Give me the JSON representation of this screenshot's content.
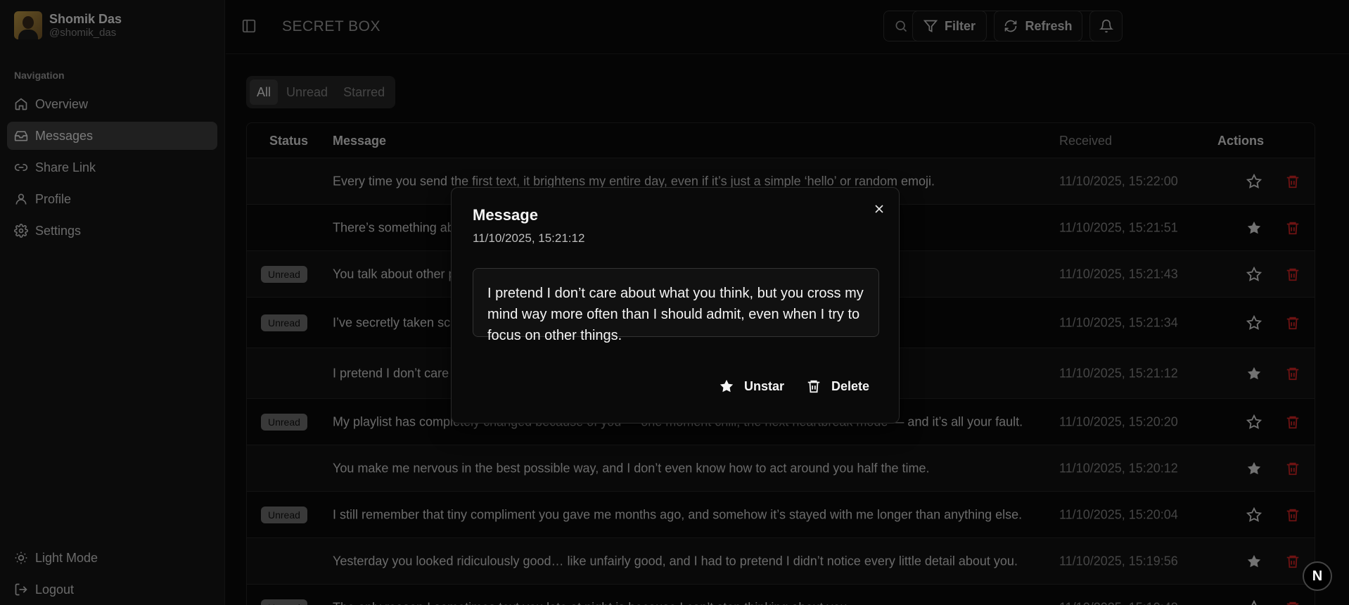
{
  "user": {
    "name": "Shomik Das",
    "handle": "@shomik_das"
  },
  "sidebar": {
    "section_label": "Navigation",
    "items": [
      {
        "label": "Overview",
        "icon": "home-icon"
      },
      {
        "label": "Messages",
        "icon": "inbox-icon",
        "active": true
      },
      {
        "label": "Share Link",
        "icon": "link-icon"
      },
      {
        "label": "Profile",
        "icon": "user-icon"
      },
      {
        "label": "Settings",
        "icon": "gear-icon"
      }
    ],
    "bottom": [
      {
        "label": "Light Mode",
        "icon": "sun-icon"
      },
      {
        "label": "Logout",
        "icon": "logout-icon"
      }
    ]
  },
  "header": {
    "title": "SECRET BOX",
    "search_placeholder": "Search...",
    "filter_label": "Filter",
    "refresh_label": "Refresh"
  },
  "tabs": [
    "All",
    "Unread",
    "Starred"
  ],
  "table": {
    "columns": {
      "status": "Status",
      "message": "Message",
      "received": "Received",
      "actions": "Actions"
    },
    "rows": [
      {
        "status": "",
        "message": "Every time you send the first text, it brightens my entire day, even if it’s just a simple ‘hello’ or random emoji.",
        "received": "11/10/2025, 15:22:00",
        "starred": false
      },
      {
        "status": "",
        "message": "There’s something ab… the most random times.",
        "received": "11/10/2025, 15:21:51",
        "starred": true
      },
      {
        "status": "Unread",
        "message": "You talk about other p… little things you do.",
        "received": "11/10/2025, 15:21:43",
        "starred": false
      },
      {
        "status": "Unread",
        "message": "I’ve secretly taken scre… w you made me feel in that moment.",
        "received": "11/10/2025, 15:21:34",
        "starred": false
      },
      {
        "status": "",
        "message": "I pretend I don’t care … even when I try to focus on other things.",
        "received": "11/10/2025, 15:21:12",
        "starred": true
      },
      {
        "status": "Unread",
        "message": "My playlist has completely changed because of you — one moment chill, the next heartbreak mode — and it’s all your fault.",
        "received": "11/10/2025, 15:20:20",
        "starred": false
      },
      {
        "status": "",
        "message": "You make me nervous in the best possible way, and I don’t even know how to act around you half the time.",
        "received": "11/10/2025, 15:20:12",
        "starred": true
      },
      {
        "status": "Unread",
        "message": "I still remember that tiny compliment you gave me months ago, and somehow it’s stayed with me longer than anything else.",
        "received": "11/10/2025, 15:20:04",
        "starred": false
      },
      {
        "status": "",
        "message": "Yesterday you looked ridiculously good… like unfairly good, and I had to pretend I didn’t notice every little detail about you.",
        "received": "11/10/2025, 15:19:56",
        "starred": true
      },
      {
        "status": "Unread",
        "message": "The only reason I sometimes text you late at night is because I can’t stop thinking about you.",
        "received": "11/10/2025, 15:19:48",
        "starred": false
      }
    ]
  },
  "modal": {
    "title": "Message",
    "timestamp": "11/10/2025, 15:21:12",
    "body": "I pretend I don’t care about what you think, but you cross my mind way more often than I should admit, even when I try to focus on other things.",
    "unstar_label": "Unstar",
    "delete_label": "Delete"
  },
  "floating_badge": "N",
  "colors": {
    "danger": "#dc2626",
    "accent_bg": "#404040"
  }
}
